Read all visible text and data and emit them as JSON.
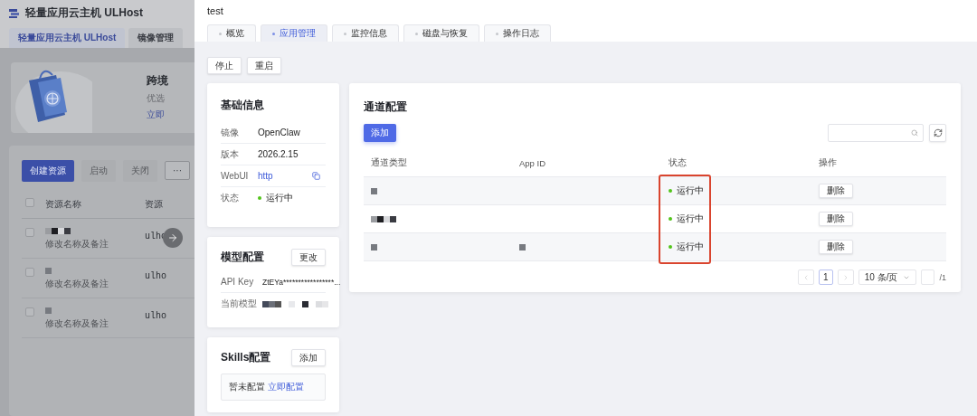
{
  "background_page": {
    "title": "轻量应用云主机 ULHost",
    "tabs": [
      {
        "label": "轻量应用云主机 ULHost",
        "selected": true
      },
      {
        "label": "镜像管理",
        "selected": false
      }
    ],
    "banner": {
      "kind": "picture",
      "heading": "跨境",
      "text": "优选",
      "link": "立即"
    },
    "toolbar": [
      {
        "label": "创建资源",
        "kind": "primary",
        "disabled": false
      },
      {
        "label": "启动",
        "kind": "default",
        "disabled": true
      },
      {
        "label": "关闭",
        "kind": "default",
        "disabled": true
      },
      {
        "label": "···",
        "kind": "outline",
        "disabled": false
      }
    ],
    "select_all_checked": false,
    "columns": [
      "资源名称",
      "资源"
    ],
    "rows": [
      {
        "checked": false,
        "name_redacted": true,
        "note": "修改名称及备注",
        "column_2": "ulho"
      },
      {
        "checked": false,
        "name_redacted": true,
        "note": "修改名称及备注",
        "column_2": "ulho"
      },
      {
        "checked": false,
        "name_redacted": true,
        "note": "修改名称及备注",
        "column_2": "ulho"
      }
    ]
  },
  "drawer": {
    "title": "test",
    "tabs": [
      {
        "label": "概览",
        "selected": false
      },
      {
        "label": "应用管理",
        "selected": true
      },
      {
        "label": "监控信息",
        "selected": false
      },
      {
        "label": "磁盘与恢复",
        "selected": false
      },
      {
        "label": "操作日志",
        "selected": false
      }
    ],
    "actions": [
      "停止",
      "重启"
    ],
    "basic_info": {
      "title": "基础信息",
      "rows": [
        {
          "label": "镜像",
          "value": "OpenClaw",
          "kind": "text"
        },
        {
          "label": "版本",
          "value": "2026.2.15",
          "kind": "text"
        },
        {
          "label": "WebUI",
          "value": "http",
          "kind": "link"
        },
        {
          "label": "状态",
          "value": "运行中",
          "kind": "status",
          "color": "#52c41a"
        }
      ]
    },
    "model": {
      "title": "模型配置",
      "button": "更改",
      "rows": [
        {
          "label": "API Key",
          "value": "ZtEYa*****************...",
          "kind": "text"
        },
        {
          "label": "当前模型",
          "kind": "masked"
        }
      ]
    },
    "skills": {
      "title": "Skills配置",
      "button": "添加",
      "empty_text": "暂未配置",
      "link": "立即配置"
    },
    "channels": {
      "title": "通道配置",
      "add_button": "添加",
      "columns": [
        "通道类型",
        "App ID",
        "状态",
        "操作"
      ],
      "rows": [
        {
          "type_redacted": true,
          "app_id_redacted": false,
          "status": "运行中",
          "color": "#52c41a",
          "action": "删除"
        },
        {
          "type_redacted": true,
          "app_id_redacted": false,
          "status": "运行中",
          "color": "#52c41a",
          "action": "删除"
        },
        {
          "type_redacted": true,
          "app_id_redacted": true,
          "status": "运行中",
          "color": "#52c41a",
          "action": "删除"
        }
      ],
      "pagination": {
        "page": "1",
        "page_size": "10 条/页",
        "total": "/1"
      }
    }
  }
}
